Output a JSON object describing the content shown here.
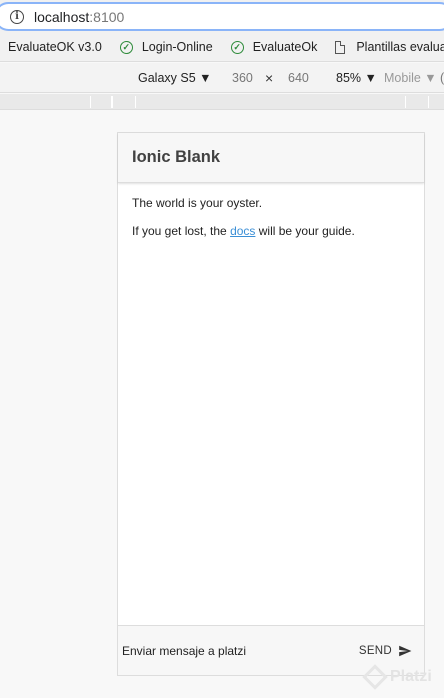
{
  "browser": {
    "url_host": "localhost",
    "url_port": ":8100"
  },
  "bookmarks": [
    {
      "label": "EvaluateOK v3.0",
      "icon": "none"
    },
    {
      "label": "Login-Online",
      "icon": "check-circle-icon"
    },
    {
      "label": "EvaluateOk",
      "icon": "check-circle-icon"
    },
    {
      "label": "Plantillas evalua",
      "icon": "document-icon"
    }
  ],
  "device_toolbar": {
    "device": "Galaxy S5 ▼",
    "width": "360",
    "times": "×",
    "height": "640",
    "zoom": "85% ▼",
    "mode": "Mobile ▼",
    "more": "("
  },
  "app": {
    "title": "Ionic Blank",
    "line1": "The world is your oyster.",
    "line2_pre": "If you get lost, the ",
    "line2_link": "docs",
    "line2_post": " will be your guide.",
    "input_placeholder": "Enviar mensaje a platzi",
    "send_label": "SEND"
  },
  "watermark": "Platzi",
  "colors": {
    "link": "#3b8fd6",
    "toolbar_bg": "#f7f7f7",
    "check_green": "#2e8b3a"
  }
}
